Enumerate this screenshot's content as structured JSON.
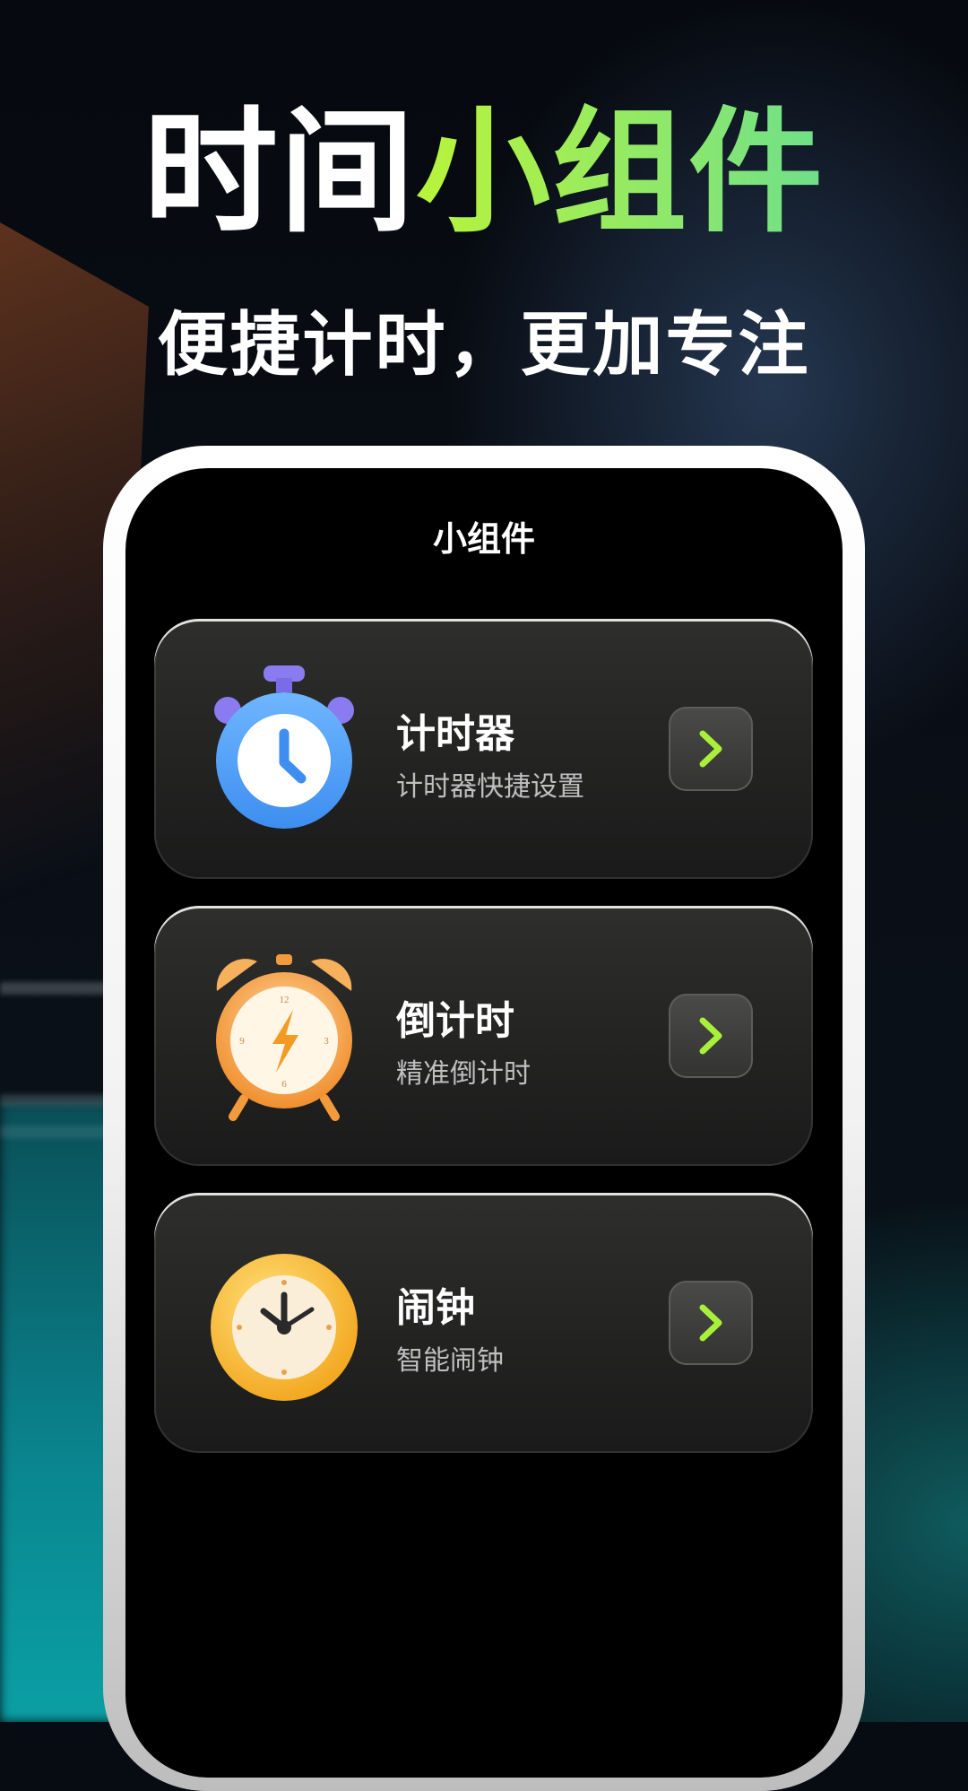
{
  "promo": {
    "title_white": "时间",
    "title_green": "小组件",
    "subtitle": "便捷计时，更加专注"
  },
  "screen": {
    "title": "小组件"
  },
  "widgets": [
    {
      "title": "计时器",
      "subtitle": "计时器快捷设置",
      "icon": "stopwatch-icon"
    },
    {
      "title": "倒计时",
      "subtitle": "精准倒计时",
      "icon": "alarm-clock-lightning-icon"
    },
    {
      "title": "闹钟",
      "subtitle": "智能闹钟",
      "icon": "wall-clock-icon"
    }
  ],
  "colors": {
    "accent_green": "#a8f03a",
    "stopwatch_blue": "#4e9df5",
    "alarm_orange": "#f5a041",
    "clock_gold": "#f5b52a"
  }
}
